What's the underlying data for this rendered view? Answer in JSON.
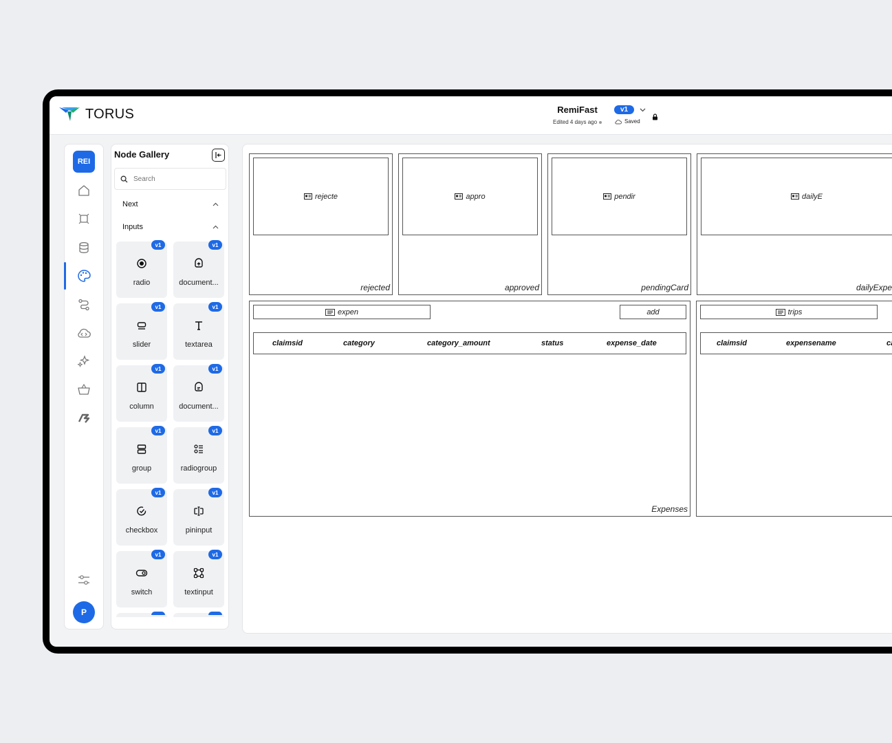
{
  "app": {
    "brand": "TORUS",
    "project_name": "RemiFast",
    "edited": "Edited 4 days ago",
    "version": "v1",
    "save_status": "Saved",
    "accent": "#1e6ae6"
  },
  "rail": {
    "avatar_initials": "REI",
    "user_initial": "P"
  },
  "gallery": {
    "title": "Node Gallery",
    "search_placeholder": "Search",
    "sections": [
      "Next",
      "Inputs"
    ],
    "tiles": [
      {
        "label": "radio",
        "badge": "v1",
        "icon": "radio-icon"
      },
      {
        "label": "document...",
        "badge": "v1",
        "icon": "document-upload-icon"
      },
      {
        "label": "slider",
        "badge": "v1",
        "icon": "slider-icon"
      },
      {
        "label": "textarea",
        "badge": "v1",
        "icon": "text-icon"
      },
      {
        "label": "column",
        "badge": "v1",
        "icon": "column-icon"
      },
      {
        "label": "document...",
        "badge": "v1",
        "icon": "document-icon"
      },
      {
        "label": "group",
        "badge": "v1",
        "icon": "group-icon"
      },
      {
        "label": "radiogroup",
        "badge": "v1",
        "icon": "radiogroup-icon"
      },
      {
        "label": "checkbox",
        "badge": "v1",
        "icon": "checkbox-icon"
      },
      {
        "label": "pininput",
        "badge": "v1",
        "icon": "pininput-icon"
      },
      {
        "label": "switch",
        "badge": "v1",
        "icon": "switch-icon"
      },
      {
        "label": "textinput",
        "badge": "v1",
        "icon": "textinput-icon"
      }
    ]
  },
  "canvas": {
    "cards": [
      {
        "inner": "rejecte",
        "caption": "rejected"
      },
      {
        "inner": "appro",
        "caption": "approved"
      },
      {
        "inner": "pendir",
        "caption": "pendingCard"
      },
      {
        "inner": "dailyE",
        "caption": "dailyExpe"
      }
    ],
    "expenses": {
      "field": "expen",
      "button": "add",
      "columns": [
        "claimsid",
        "category",
        "category_amount",
        "status",
        "expense_date"
      ],
      "caption": "Expenses"
    },
    "trips": {
      "field": "trips",
      "columns": [
        "claimsid",
        "expensename",
        "ca"
      ]
    }
  }
}
